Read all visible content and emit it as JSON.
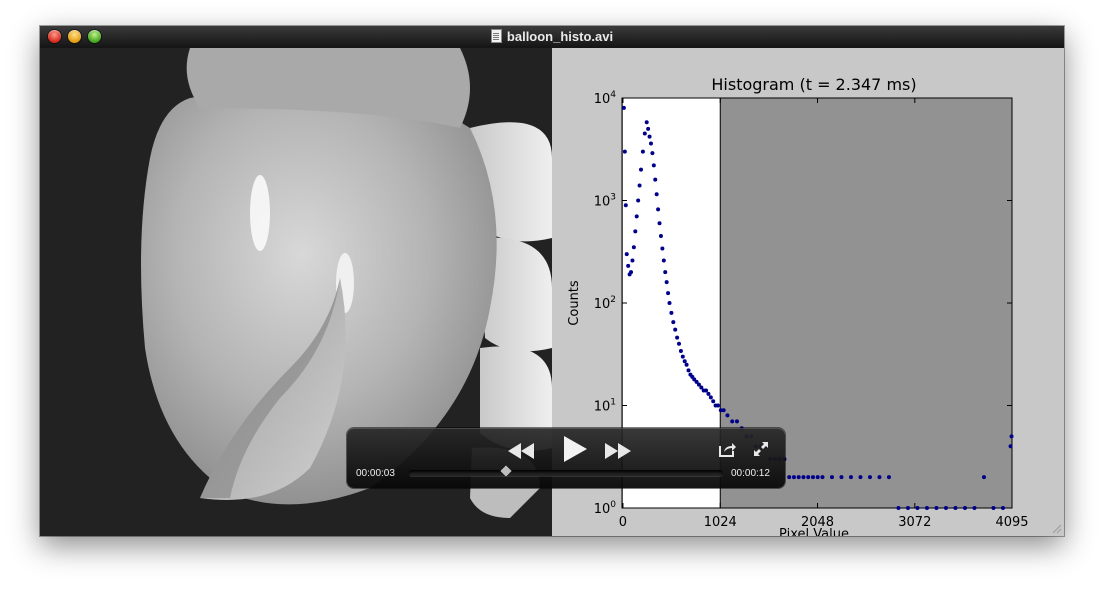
{
  "window": {
    "title": "balloon_histo.avi"
  },
  "player": {
    "current_time": "00:00:03",
    "duration": "00:00:12",
    "progress_fraction": 0.31,
    "buttons": {
      "rewind": "rewind-icon",
      "play": "play-icon",
      "fast_forward": "fast-forward-icon",
      "share": "share-icon",
      "fullscreen": "fullscreen-icon"
    }
  },
  "chart_data": {
    "type": "scatter",
    "title": "Histogram (t = 2.347 ms)",
    "xlabel": "Pixel Value",
    "ylabel": "Counts",
    "xlim": [
      -10,
      4095
    ],
    "ylim": [
      1,
      10000
    ],
    "yscale": "log",
    "xticks": [
      0,
      1024,
      2048,
      3072,
      4095
    ],
    "xtick_labels": [
      "0",
      "1024",
      "2048",
      "3072",
      "4095"
    ],
    "ytick_labels": [
      "10^0",
      "10^1",
      "10^2",
      "10^3",
      "10^4"
    ],
    "highlight_region": {
      "x_from": 0,
      "x_to": 1024,
      "color": "#ffffff"
    },
    "outside_region_color": "#929292",
    "marker_color": "#00008b",
    "series": [
      {
        "x": [
          10,
          20,
          30,
          40,
          55,
          70,
          85,
          100,
          115,
          130,
          145,
          160,
          175,
          190,
          210,
          230,
          250,
          265,
          280,
          295,
          310,
          325,
          340,
          355,
          370,
          385,
          400,
          415,
          430,
          445,
          460,
          475,
          490,
          510,
          530,
          550,
          570,
          590,
          610,
          630,
          650,
          670,
          690,
          710,
          730,
          750,
          775,
          800,
          825,
          850,
          875,
          900,
          925,
          950,
          975,
          1000,
          1030,
          1060,
          1100,
          1150,
          1200,
          1250,
          1300,
          1350,
          1400,
          1450,
          1500,
          1550,
          1600,
          1650,
          1700,
          1750,
          1800,
          1850,
          1900,
          1950,
          2000,
          2050,
          2100,
          2200,
          2300,
          2400,
          2500,
          2600,
          2700,
          2800,
          2900,
          3000,
          3100,
          3200,
          3300,
          3400,
          3500,
          3600,
          3700,
          3800,
          3900,
          4000,
          4080,
          4090
        ],
        "y": [
          8000,
          3000,
          900,
          300,
          230,
          190,
          200,
          260,
          350,
          500,
          700,
          1000,
          1400,
          2000,
          3000,
          4500,
          5800,
          5000,
          4200,
          3600,
          2900,
          2200,
          1600,
          1150,
          820,
          600,
          450,
          340,
          260,
          200,
          160,
          125,
          100,
          80,
          65,
          55,
          46,
          40,
          34,
          30,
          27,
          25,
          22,
          20,
          19,
          18,
          17,
          16,
          15,
          14,
          14,
          13,
          12,
          11,
          10,
          10,
          9,
          9,
          8,
          7,
          7,
          6,
          5,
          5,
          4,
          4,
          4,
          3,
          3,
          3,
          3,
          2,
          2,
          2,
          2,
          2,
          2,
          2,
          2,
          2,
          2,
          2,
          2,
          2,
          2,
          2,
          1,
          1,
          1,
          1,
          1,
          1,
          1,
          1,
          1,
          2,
          1,
          1,
          4,
          5
        ]
      }
    ]
  }
}
